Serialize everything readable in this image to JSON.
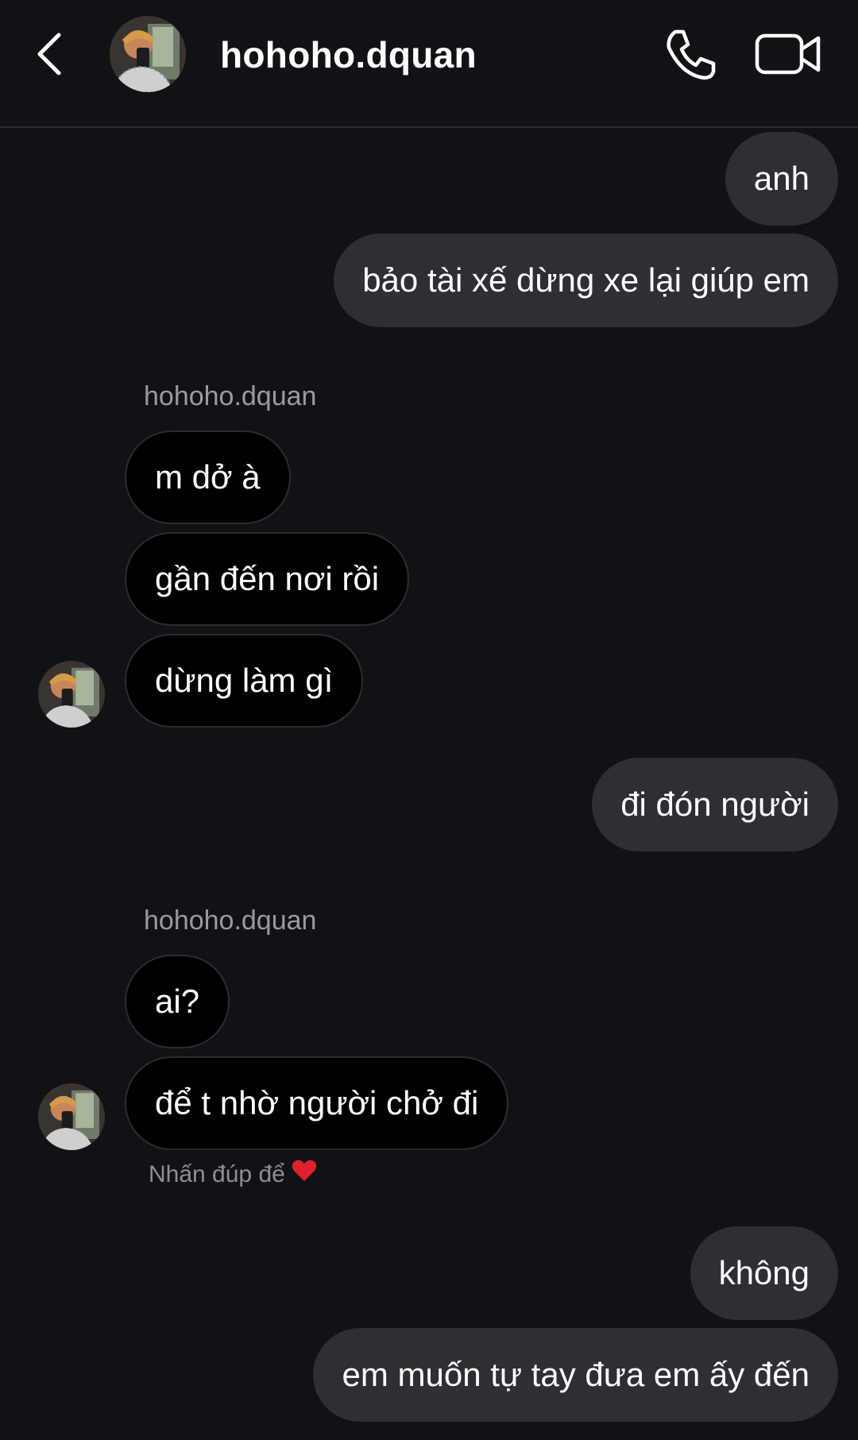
{
  "header": {
    "username": "hohoho.dquan"
  },
  "icons": {
    "back": "chevron-left-icon",
    "call": "phone-icon",
    "video": "video-camera-icon",
    "heart": "heart-icon"
  },
  "colors": {
    "background": "#111216",
    "outgoing_bubble": "#2e2f33",
    "incoming_bubble": "#000000",
    "secondary_text": "#9a9ba1",
    "heart": "#e0202f"
  },
  "messages": [
    {
      "direction": "outgoing",
      "text": "anh"
    },
    {
      "direction": "outgoing",
      "text": "bảo tài xế dừng xe lại giúp em"
    },
    {
      "direction": "incoming",
      "sender": "hohoho.dquan",
      "text": "m dở à"
    },
    {
      "direction": "incoming",
      "text": "gần đến nơi rồi"
    },
    {
      "direction": "incoming",
      "text": "dừng làm gì"
    },
    {
      "direction": "outgoing",
      "text": "đi đón người"
    },
    {
      "direction": "incoming",
      "sender": "hohoho.dquan",
      "text": "ai?"
    },
    {
      "direction": "incoming",
      "text": "để t nhờ người chở đi"
    },
    {
      "direction": "outgoing",
      "text": "không"
    },
    {
      "direction": "outgoing",
      "text": "em muốn tự tay đưa em ấy đến"
    }
  ],
  "hint": {
    "text": "Nhấn đúp để"
  }
}
